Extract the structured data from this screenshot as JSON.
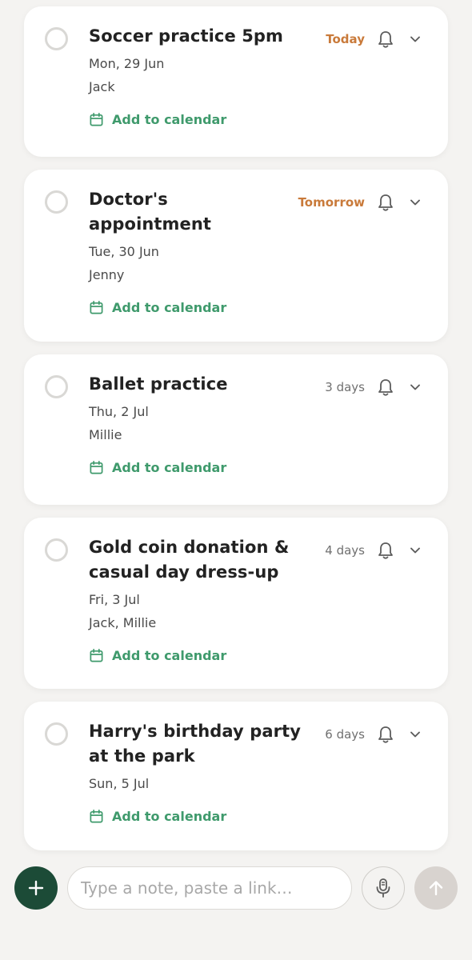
{
  "tasks": [
    {
      "title": "Soccer practice 5pm",
      "date": "Mon, 29 Jun",
      "people": "Jack",
      "due": "Today",
      "due_highlight": true,
      "calendar_label": "Add to calendar"
    },
    {
      "title": "Doctor's appointment",
      "date": "Tue, 30 Jun",
      "people": "Jenny",
      "due": "Tomorrow",
      "due_highlight": true,
      "calendar_label": "Add to calendar"
    },
    {
      "title": "Ballet practice",
      "date": "Thu, 2 Jul",
      "people": "Millie",
      "due": "3 days",
      "due_highlight": false,
      "calendar_label": "Add to calendar"
    },
    {
      "title": "Gold coin donation & casual day dress-up",
      "date": "Fri, 3 Jul",
      "people": "Jack, Millie",
      "due": "4 days",
      "due_highlight": false,
      "calendar_label": "Add to calendar"
    },
    {
      "title": "Harry's birthday party at the park",
      "date": "Sun, 5 Jul",
      "people": "",
      "due": "6 days",
      "due_highlight": false,
      "calendar_label": "Add to calendar"
    }
  ],
  "composer": {
    "placeholder": "Type a note, paste a link…",
    "value": ""
  },
  "icons": {
    "add": "plus-icon",
    "mic": "microphone-icon",
    "send": "arrow-up-icon",
    "reminder": "bell-icon",
    "expand": "chevron-down-icon",
    "calendar": "calendar-icon",
    "complete": "checkbox-circle"
  },
  "colors": {
    "background": "#f4f3f1",
    "card": "#ffffff",
    "accent_green": "#3f9a6c",
    "fab_green": "#1c4b37",
    "due_soon": "#c97a3a",
    "send_disabled": "#d8d3cf"
  }
}
